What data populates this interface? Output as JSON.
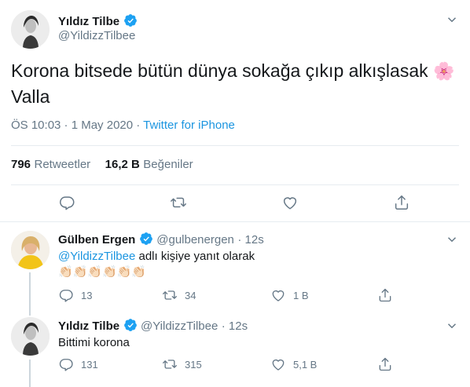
{
  "main_tweet": {
    "name": "Yıldız Tilbe",
    "handle": "@YildizzTilbee",
    "text_line1": "Korona bitsede bütün dünya sokağa çıkıp alkışlasak",
    "text_emoji": "🌸",
    "text_line2": "Valla",
    "timestamp": "ÖS 10:03 · 1 May 2020 · ",
    "source": "Twitter for iPhone",
    "retweet_count": "796",
    "retweet_label": "Retweetler",
    "like_count": "16,2 B",
    "like_label": "Beğeniler"
  },
  "replies": [
    {
      "name": "Gülben Ergen",
      "handle": "@gulbenergen",
      "time": "· 12s",
      "reply_to_handle": "@YildizzTilbee",
      "reply_to_suffix": " adlı kişiye yanıt olarak",
      "text": "👏🏻👏🏻👏🏻👏🏻👏🏻👏🏻",
      "reply_count": "13",
      "retweet_count": "34",
      "like_count": "1 B"
    },
    {
      "name": "Yıldız Tilbe",
      "handle": "@YildizzTilbee",
      "time": "· 12s",
      "text": "Bittimi korona",
      "reply_count": "131",
      "retweet_count": "315",
      "like_count": "5,1 B"
    }
  ],
  "colors": {
    "accent": "#1b95e0",
    "secondary_text": "#657786",
    "divider": "#e6ecf0"
  },
  "icons": [
    "verified-badge-icon",
    "chevron-down-icon",
    "reply-icon",
    "retweet-icon",
    "like-icon",
    "share-icon"
  ]
}
